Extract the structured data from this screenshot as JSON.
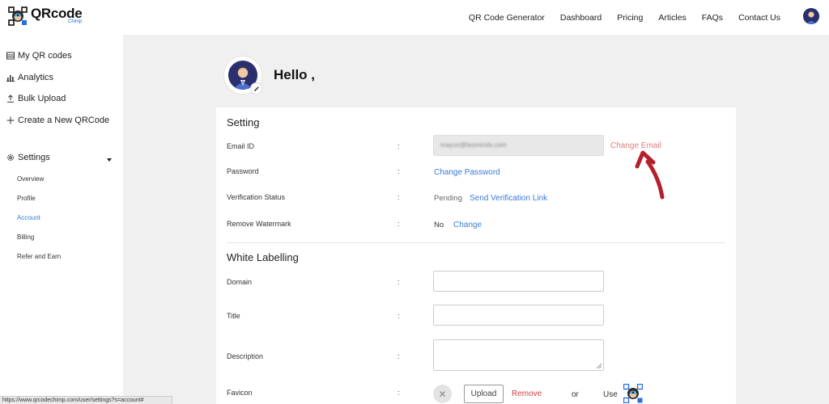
{
  "brand": {
    "name": "QRcode",
    "tagline": "Chimp"
  },
  "nav": {
    "items": [
      "QR Code Generator",
      "Dashboard",
      "Pricing",
      "Articles",
      "FAQs",
      "Contact Us"
    ]
  },
  "sidebar": {
    "items": [
      {
        "label": "My QR codes",
        "icon": "list-icon"
      },
      {
        "label": "Analytics",
        "icon": "bar-chart-icon"
      },
      {
        "label": "Bulk Upload",
        "icon": "upload-icon"
      },
      {
        "label": "Create a New QRCode",
        "icon": "plus-icon"
      }
    ],
    "settings": {
      "label": "Settings",
      "icon": "gear-icon",
      "subitems": [
        "Overview",
        "Profile",
        "Account",
        "Billing",
        "Refer and Earn"
      ],
      "active": "Account"
    }
  },
  "profile": {
    "greeting": "Hello ,"
  },
  "setting": {
    "title": "Setting",
    "colon": ":",
    "email": {
      "label": "Email ID",
      "value": "mayuri@tezminds.com",
      "action": "Change Email"
    },
    "password": {
      "label": "Password",
      "action": "Change Password"
    },
    "verification": {
      "label": "Verification Status",
      "status": "Pending",
      "action": "Send Verification Link"
    },
    "watermark": {
      "label": "Remove Watermark",
      "status": "No",
      "action": "Change"
    }
  },
  "white_labelling": {
    "title": "White Labelling",
    "domain": {
      "label": "Domain",
      "value": ""
    },
    "title_field": {
      "label": "Title",
      "value": ""
    },
    "description": {
      "label": "Description",
      "value": ""
    },
    "favicon": {
      "label": "Favicon",
      "upload": "Upload",
      "remove": "Remove",
      "or": "or",
      "use": "Use"
    }
  },
  "statusbar": {
    "url": "https://www.qrcodechimp.com/user/settings?s=account#"
  },
  "colors": {
    "accent": "#3a7bd5",
    "annotation": "#b5202a",
    "remove": "#d04040"
  }
}
